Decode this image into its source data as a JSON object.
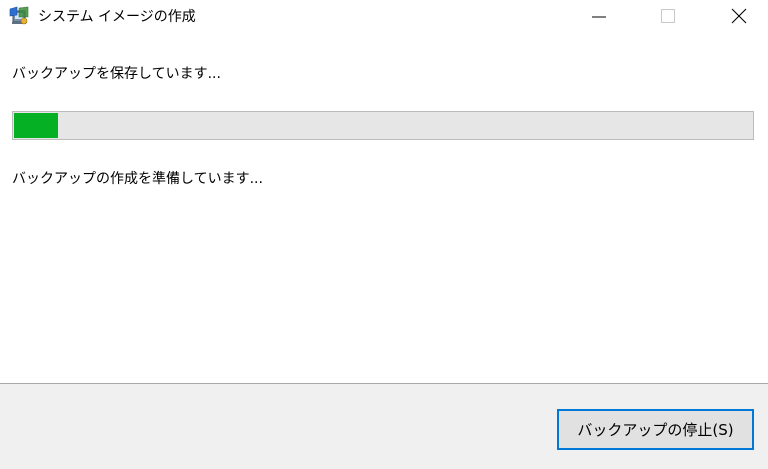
{
  "window": {
    "title": "システム イメージの作成",
    "icon": "system-image-backup-icon",
    "controls": {
      "minimize_icon": "minimize-icon",
      "maximize_icon": "maximize-icon",
      "close_icon": "close-icon"
    }
  },
  "main": {
    "status_text": "バックアップを保存しています...",
    "progress": {
      "percent": 6,
      "fill_color": "#06b025",
      "track_color": "#e6e6e6"
    },
    "substatus_text": "バックアップの作成を準備しています..."
  },
  "footer": {
    "stop_button_label": "バックアップの停止(S)",
    "button_focus_color": "#0078d7"
  }
}
